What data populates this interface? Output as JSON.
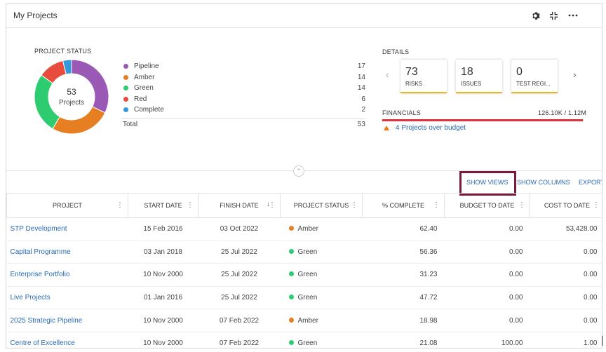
{
  "header": {
    "title": "My Projects",
    "icons": [
      "gear-icon",
      "collapse-icon",
      "more-icon"
    ]
  },
  "project_status": {
    "label": "PROJECT STATUS",
    "center_value": "53",
    "center_label": "Projects",
    "items": [
      {
        "label": "Pipeline",
        "value": "17",
        "color": "#9b59b6"
      },
      {
        "label": "Amber",
        "value": "14",
        "color": "#e67e22"
      },
      {
        "label": "Green",
        "value": "14",
        "color": "#2ecc71"
      },
      {
        "label": "Red",
        "value": "6",
        "color": "#e74c3c"
      },
      {
        "label": "Complete",
        "value": "2",
        "color": "#3498db"
      }
    ],
    "total_label": "Total",
    "total_value": "53"
  },
  "details": {
    "label": "DETAILS",
    "cards": [
      {
        "value": "73",
        "label": "RISKS"
      },
      {
        "value": "18",
        "label": "ISSUES"
      },
      {
        "value": "0",
        "label": "TEST REGI..."
      }
    ],
    "financials_label": "FINANCIALS",
    "financials_value": "126.10K / 1.12M",
    "warning": "4 Projects over budget"
  },
  "actions": {
    "show_views": "SHOW VIEWS",
    "show_columns": "SHOW COLUMNS",
    "export": "EXPORT"
  },
  "table": {
    "columns": [
      "PROJECT",
      "START DATE",
      "FINISH DATE",
      "PROJECT STATUS",
      "% COMPLETE",
      "BUDGET TO DATE",
      "COST TO DATE"
    ],
    "rows": [
      {
        "project": "STP Development",
        "start": "15 Feb 2016",
        "finish": "03 Oct 2022",
        "status": "Amber",
        "status_color": "#e67e22",
        "complete": "62.40",
        "budget": "0.00",
        "cost": "53,428.00"
      },
      {
        "project": "Capital Programme",
        "start": "03 Jan 2018",
        "finish": "25 Jul 2022",
        "status": "Green",
        "status_color": "#2ecc71",
        "complete": "56.36",
        "budget": "0.00",
        "cost": "0.00"
      },
      {
        "project": "Enterprise Portfolio",
        "start": "10 Nov 2000",
        "finish": "25 Jul 2022",
        "status": "Green",
        "status_color": "#2ecc71",
        "complete": "31.23",
        "budget": "0.00",
        "cost": "0.00"
      },
      {
        "project": "Live Projects",
        "start": "01 Jan 2016",
        "finish": "25 Jul 2022",
        "status": "Green",
        "status_color": "#2ecc71",
        "complete": "47.72",
        "budget": "0.00",
        "cost": "0.00"
      },
      {
        "project": "2025 Strategic Pipeline",
        "start": "10 Nov 2000",
        "finish": "07 Feb 2022",
        "status": "Amber",
        "status_color": "#e67e22",
        "complete": "18.98",
        "budget": "0.00",
        "cost": "0.00"
      },
      {
        "project": "Centre of Excellence",
        "start": "10 Nov 2000",
        "finish": "07 Feb 2022",
        "status": "Green",
        "status_color": "#2ecc71",
        "complete": "21.08",
        "budget": "100.00",
        "cost": "1.00"
      }
    ]
  }
}
